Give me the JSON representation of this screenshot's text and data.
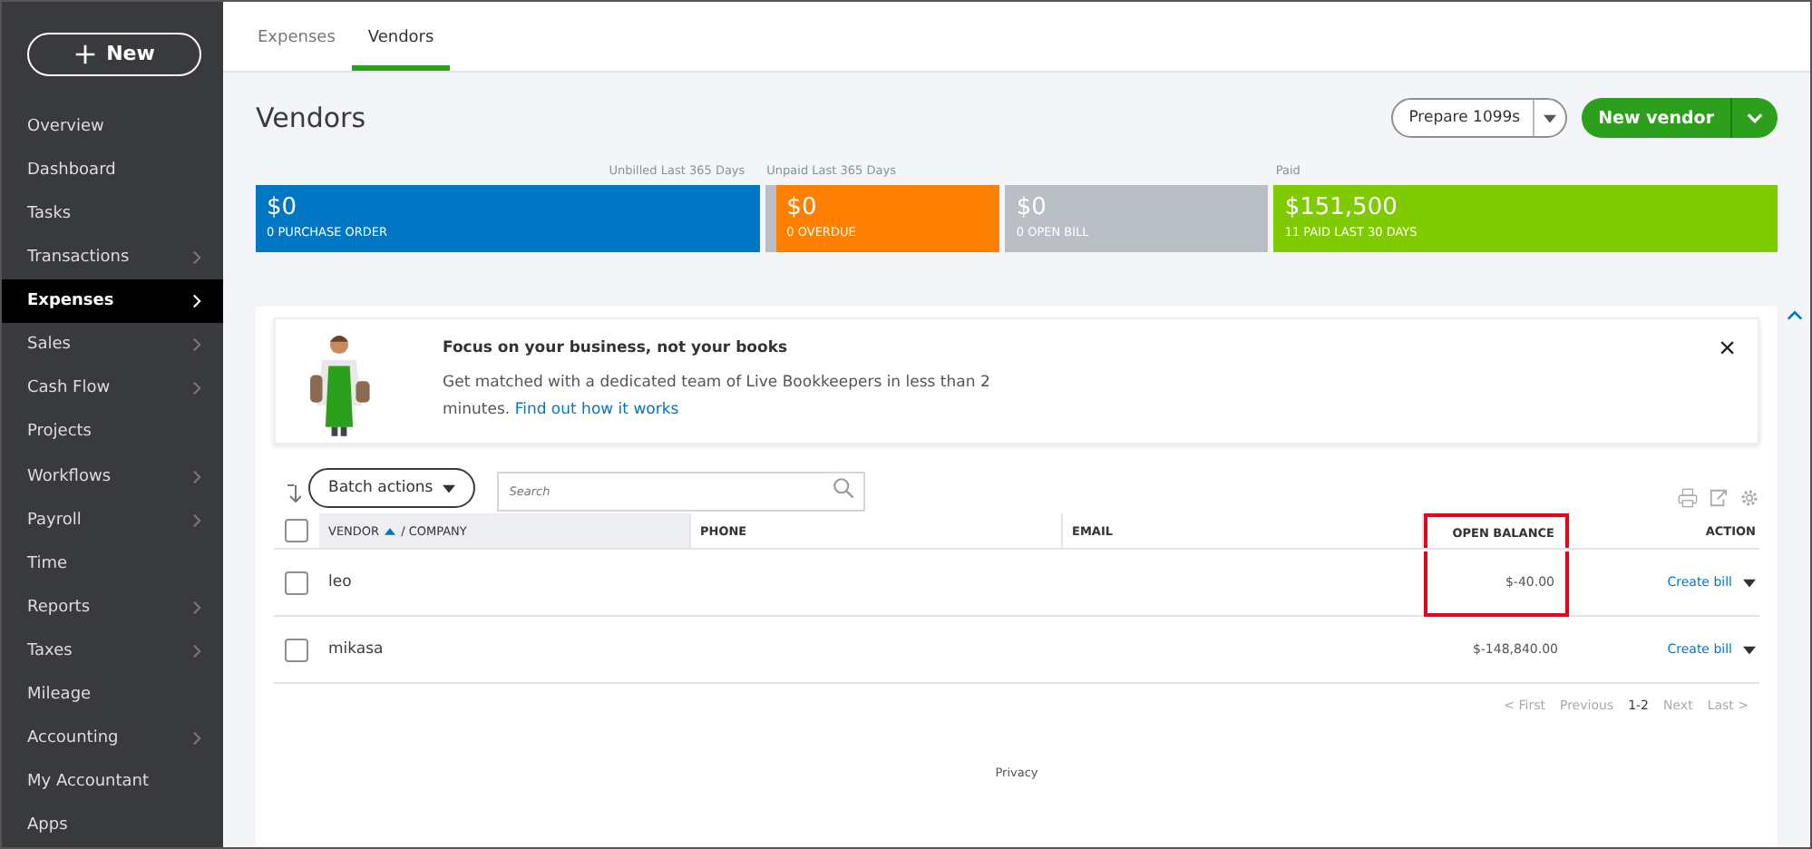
{
  "sidebar": {
    "new_button": "New",
    "items": [
      {
        "label": "Overview",
        "has_submenu": false,
        "selected": false
      },
      {
        "label": "Dashboard",
        "has_submenu": false,
        "selected": false
      },
      {
        "label": "Tasks",
        "has_submenu": false,
        "selected": false
      },
      {
        "label": "Transactions",
        "has_submenu": true,
        "selected": false
      },
      {
        "label": "Expenses",
        "has_submenu": true,
        "selected": true
      },
      {
        "label": "Sales",
        "has_submenu": true,
        "selected": false
      },
      {
        "label": "Cash Flow",
        "has_submenu": true,
        "selected": false
      },
      {
        "label": "Projects",
        "has_submenu": false,
        "selected": false
      },
      {
        "label": "Workflows",
        "has_submenu": true,
        "selected": false
      },
      {
        "label": "Payroll",
        "has_submenu": true,
        "selected": false
      },
      {
        "label": "Time",
        "has_submenu": false,
        "selected": false
      },
      {
        "label": "Reports",
        "has_submenu": true,
        "selected": false
      },
      {
        "label": "Taxes",
        "has_submenu": true,
        "selected": false
      },
      {
        "label": "Mileage",
        "has_submenu": false,
        "selected": false
      },
      {
        "label": "Accounting",
        "has_submenu": true,
        "selected": false
      },
      {
        "label": "My Accountant",
        "has_submenu": false,
        "selected": false
      },
      {
        "label": "Apps",
        "has_submenu": false,
        "selected": false
      }
    ]
  },
  "tabs": [
    {
      "label": "Expenses",
      "selected": false
    },
    {
      "label": "Vendors",
      "selected": true
    }
  ],
  "page_title": "Vendors",
  "header_buttons": {
    "prepare": "Prepare 1099s",
    "new_vendor": "New vendor"
  },
  "summary": {
    "groups": [
      {
        "label": "Unbilled Last 365 Days",
        "tiles": [
          {
            "amount": "$0",
            "caption": "0 PURCHASE ORDER",
            "color": "#0077c5"
          }
        ]
      },
      {
        "label": "Unpaid Last 365 Days",
        "tiles": [
          {
            "amount": "$0",
            "caption": "0 OVERDUE",
            "color": "#ff8000"
          },
          {
            "amount": "$0",
            "caption": "0 OPEN BILL",
            "color": "#babec5"
          }
        ]
      },
      {
        "label": "Paid",
        "tiles": [
          {
            "amount": "$151,500",
            "caption": "11 PAID LAST 30 DAYS",
            "color": "#7fcb00"
          }
        ]
      }
    ]
  },
  "banner": {
    "title": "Focus on your business, not your books",
    "text": "Get matched with a dedicated team of Live Bookkeepers in less than 2 minutes.",
    "link": "Find out how it works",
    "close": "×"
  },
  "toolbar": {
    "batch_actions": "Batch actions",
    "search": {
      "placeholder": "Search"
    }
  },
  "table": {
    "select_all_checked": false,
    "columns": [
      {
        "label": "VENDOR",
        "sub_label": "/ COMPANY",
        "sorted_ascending": true,
        "highlighted": false
      },
      {
        "label": "PHONE",
        "highlighted": false
      },
      {
        "label": "EMAIL",
        "highlighted": false
      },
      {
        "label": "OPEN BALANCE",
        "highlighted": true
      },
      {
        "label": "ACTION",
        "highlighted": false
      }
    ],
    "rows": [
      {
        "checked": false,
        "vendor": "leo",
        "open_balance": "$-40.00",
        "action": "Create bill"
      },
      {
        "checked": false,
        "vendor": "mikasa",
        "open_balance": "$-148,840.00",
        "action": "Create bill"
      }
    ]
  },
  "pagination": [
    {
      "label": "< First",
      "disabled": true
    },
    {
      "label": "Previous",
      "disabled": true
    },
    {
      "label": "1-2",
      "disabled": false
    },
    {
      "label": "Next",
      "disabled": true
    },
    {
      "label": "Last >",
      "disabled": true
    }
  ],
  "footer": "Privacy"
}
